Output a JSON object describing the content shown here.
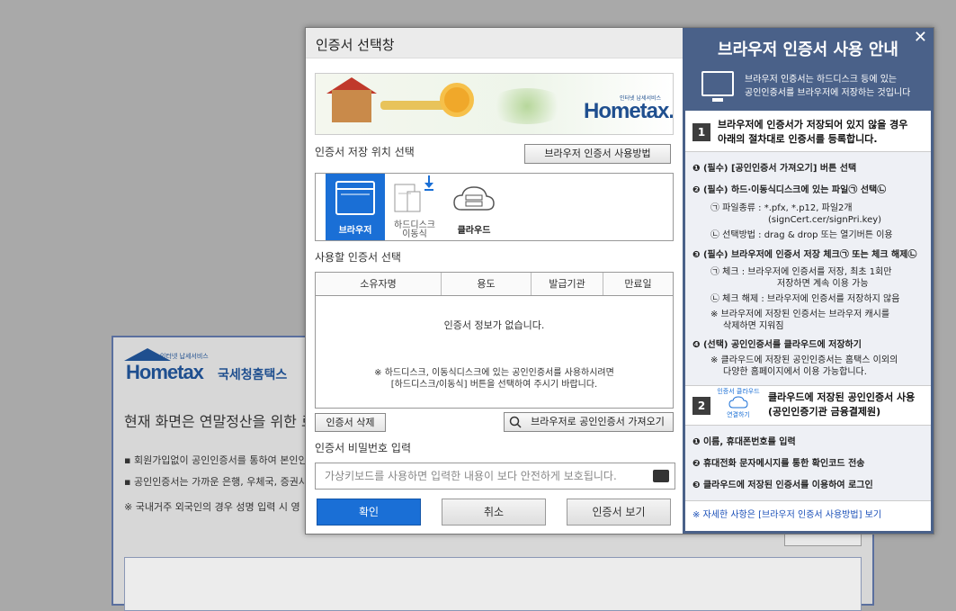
{
  "background": {
    "logo_sub": "인터넷 납세서비스",
    "logo_brand": "Hometax",
    "logo_brand_kr": "국세청홈택스",
    "heading": "현재 화면은 연말정산을 위한 로",
    "bullets": [
      "▪ 회원가입없이 공인인증서를 통하여 본인인",
      "▪ 공인인증서는 가까운 은행, 우체국, 증권사",
      "※ 국내거주 외국인의 경우 성명 입력 시 영"
    ]
  },
  "dialog": {
    "title": "인증서 선택창",
    "banner": {
      "sub": "인터넷 납세서비스",
      "brand": "Hometax."
    },
    "location_label": "인증서 저장 위치 선택",
    "browser_usage_btn": "브라우저 인증서 사용방법",
    "locations": [
      {
        "label": "브라우저",
        "icon": "browser-icon",
        "selected": true
      },
      {
        "label": "하드디스크\n이동식",
        "icon": "harddisk-usb-icon",
        "selected": false
      },
      {
        "label": "클라우드",
        "icon": "cloud-icon",
        "selected": false
      }
    ],
    "cert_select_label": "사용할 인증서 선택",
    "table": {
      "columns": [
        "소유자명",
        "용도",
        "발급기관",
        "만료일"
      ],
      "empty_message": "인증서 정보가 없습니다.",
      "hint_line1": "※ 하드디스크, 이동식디스크에 있는 공인인증서를 사용하시려면",
      "hint_line2": "[하드디스크/이동식] 버튼을 선택하여 주시기 바랍니다."
    },
    "delete_btn": "인증서 삭제",
    "import_btn": "브라우저로 공인인증서 가져오기",
    "password_label": "인증서 비밀번호 입력",
    "password_placeholder": "가상키보드를 사용하면 입력한 내용이 보다 안전하게 보호됩니다.",
    "ok_btn": "확인",
    "cancel_btn": "취소",
    "view_btn": "인증서 보기",
    "accent_color": "#1a6fd6"
  },
  "help": {
    "title": "브라우저 인증서 사용 안내",
    "close": "✕",
    "intro_line1": "브라우저 인증서는 하드디스크 등에 있는",
    "intro_line2": "공인인증서를 브라우저에 저장하는 것입니다",
    "step1_num": "1",
    "step1_line1": "브라우저에 인증서가 저장되어 있지 않을 경우",
    "step1_line2": "아래의 절차대로 인증서를 등록합니다.",
    "s1": [
      "❶ (필수) [공인인증서 가져오기] 버튼 선택",
      "❷ (필수) 하드·이동식디스크에 있는 파일㉠ 선택㉡",
      "㉠ 파일종류 : *.pfx, *.p12, 파일2개",
      "(signCert.cer/signPri.key)",
      "㉡ 선택방법 : drag & drop 또는 열기버튼 이용",
      "❸ (필수) 브라우저에 인증서 저장 체크㉠ 또는 체크 해제㉡",
      "㉠ 체크 :  브라우저에 인증서를 저장, 최초 1회만",
      "저장하면 계속 이용 가능",
      "㉡ 체크 해제 : 브라우저에 인증서를 저장하지 않음",
      "※ 브라우저에 저장된 인증서는 브라우저 캐시를",
      "삭제하면 지워짐",
      "❹ (선택) 공인인증서를 클라우드에 저장하기",
      "※ 클라우드에 저장된 공인인증서는 홈택스 이외의",
      "다양한 홈페이지에서 이용 가능합니다."
    ],
    "step2_num": "2",
    "step2_icon_top": "인증서 클라우드",
    "step2_icon_bottom": "연결하기",
    "step2_line1": "클라우드에 저장된 공인인증서 사용",
    "step2_line2": "(공인인증기관 금융결제원)",
    "s2": [
      "❶ 이름, 휴대폰번호를 입력",
      "❷ 휴대전화 문자메시지를 통한 확인코드 전송",
      "❸ 클라우드에 저장된 인증서를 이용하여 로그인"
    ],
    "more": "※ 자세한 사항은 [브라우저 인증서 사용방법] 보기"
  }
}
